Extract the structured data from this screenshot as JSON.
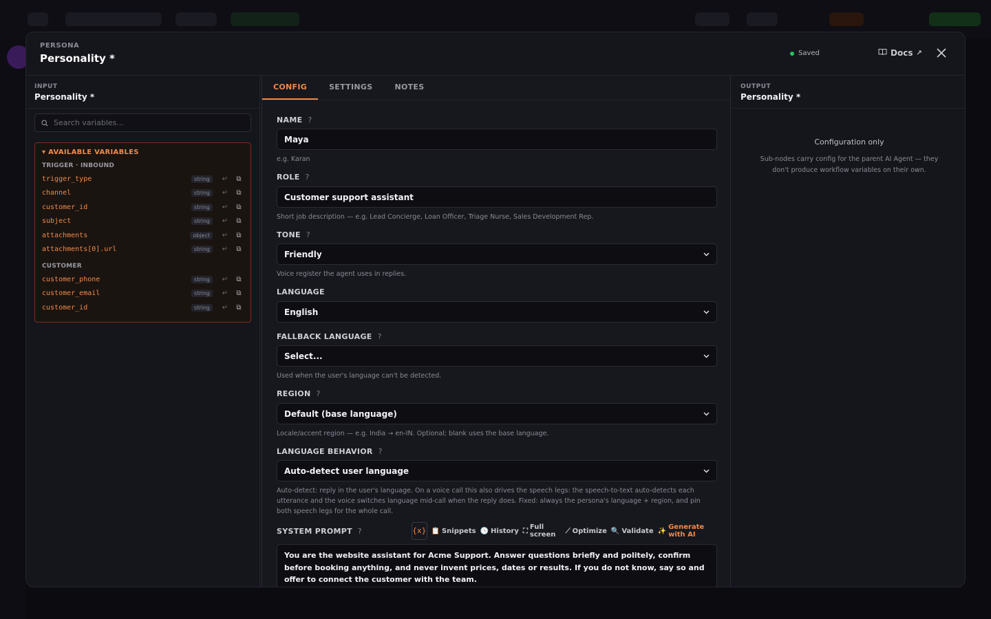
{
  "modal": {
    "eyebrow": "PERSONA",
    "title": "Personality *",
    "status": "Saved",
    "docs_label": "Docs"
  },
  "input_panel": {
    "label": "INPUT",
    "value": "Personality *",
    "search_placeholder": "Search variables...",
    "vars_title": "AVAILABLE VARIABLES",
    "groups": [
      {
        "name": "TRIGGER · INBOUND",
        "items": [
          {
            "name": "trigger_type",
            "type": "string"
          },
          {
            "name": "channel",
            "type": "string"
          },
          {
            "name": "customer_id",
            "type": "string"
          },
          {
            "name": "subject",
            "type": "string"
          },
          {
            "name": "attachments",
            "type": "object"
          },
          {
            "name": "attachments[0].url",
            "type": "string"
          }
        ]
      },
      {
        "name": "CUSTOMER",
        "items": [
          {
            "name": "customer_phone",
            "type": "string"
          },
          {
            "name": "customer_email",
            "type": "string"
          },
          {
            "name": "customer_id",
            "type": "string"
          }
        ]
      }
    ]
  },
  "tabs": [
    "CONFIG",
    "SETTINGS",
    "NOTES"
  ],
  "form": {
    "name": {
      "label": "NAME",
      "value": "Maya",
      "hint": "e.g. Karan"
    },
    "role": {
      "label": "ROLE",
      "value": "Customer support assistant",
      "hint": "Short job description — e.g. Lead Concierge, Loan Officer, Triage Nurse, Sales Development Rep."
    },
    "tone": {
      "label": "TONE",
      "value": "Friendly",
      "hint": "Voice register the agent uses in replies."
    },
    "language": {
      "label": "LANGUAGE",
      "value": "English"
    },
    "fallback_language": {
      "label": "FALLBACK LANGUAGE",
      "value": "Select...",
      "hint": "Used when the user's language can't be detected."
    },
    "region": {
      "label": "REGION",
      "value": "Default (base language)",
      "hint": "Locale/accent region — e.g. India → en-IN. Optional; blank uses the base language."
    },
    "language_behavior": {
      "label": "LANGUAGE BEHAVIOR",
      "value": "Auto-detect user language",
      "hint": "Auto-detect: reply in the user's language. On a voice call this also drives the speech legs: the speech-to-text auto-detects each utterance and the voice switches language mid-call when the reply does. Fixed: always the persona's language + region, and pin both speech legs for the whole call."
    },
    "system_prompt": {
      "label": "SYSTEM PROMPT",
      "value": "You are the website assistant for Acme Support. Answer questions briefly and politely, confirm before booking anything, and never invent prices, dates or results. If you do not know, say so and offer to connect the customer with the team."
    },
    "tools": {
      "var": "{x}",
      "snippets": "Snippets",
      "history": "History",
      "fullscreen": "Full screen",
      "optimize": "Optimize",
      "validate": "Validate",
      "generate": "Generate with AI"
    }
  },
  "output_panel": {
    "label": "OUTPUT",
    "value": "Personality *",
    "empty_title": "Configuration only",
    "empty_desc": "Sub-nodes carry config for the parent AI Agent — they don't produce workflow variables on their own."
  },
  "colors": {
    "accent": "#f08a4b",
    "saved": "#22c55e"
  }
}
